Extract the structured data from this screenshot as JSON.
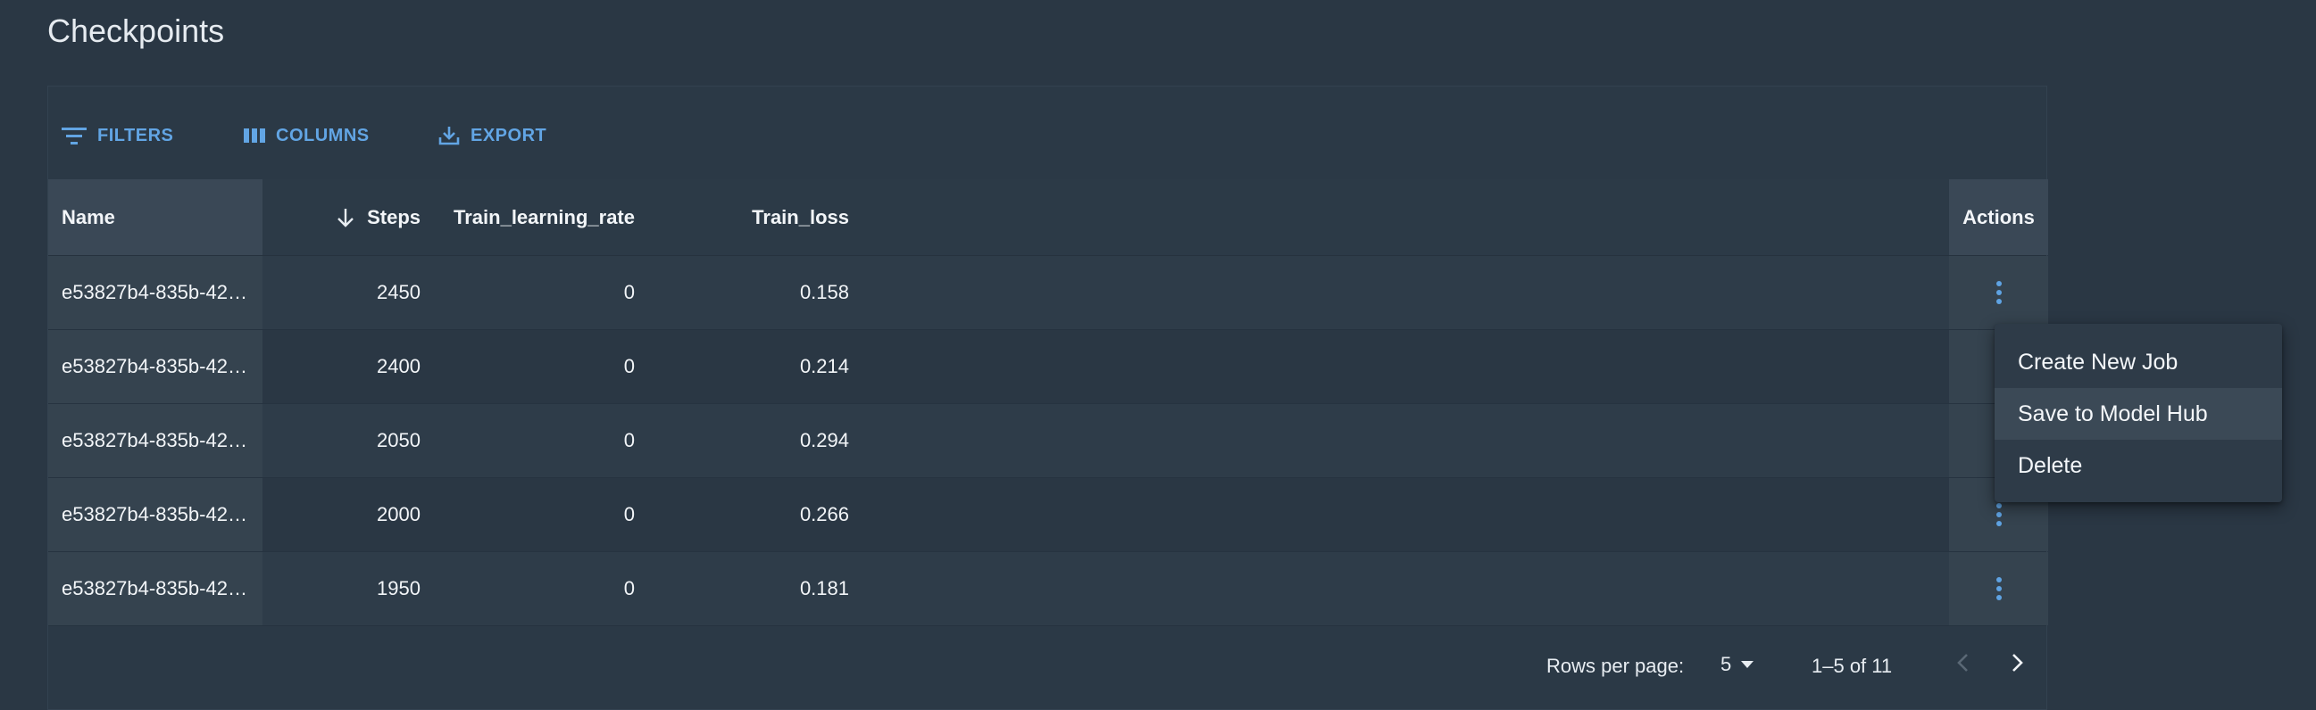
{
  "page": {
    "title": "Checkpoints"
  },
  "toolbar": {
    "filters_label": "FILTERS",
    "columns_label": "COLUMNS",
    "export_label": "EXPORT"
  },
  "table": {
    "headers": {
      "name": "Name",
      "steps": "Steps",
      "lr": "Train_learning_rate",
      "loss": "Train_loss",
      "actions": "Actions"
    },
    "sort": {
      "column": "Steps",
      "direction": "descending"
    },
    "rows": [
      {
        "name": "e53827b4-835b-42…",
        "steps": "2450",
        "lr": "0",
        "loss": "0.158"
      },
      {
        "name": "e53827b4-835b-42…",
        "steps": "2400",
        "lr": "0",
        "loss": "0.214"
      },
      {
        "name": "e53827b4-835b-42…",
        "steps": "2050",
        "lr": "0",
        "loss": "0.294"
      },
      {
        "name": "e53827b4-835b-42…",
        "steps": "2000",
        "lr": "0",
        "loss": "0.266"
      },
      {
        "name": "e53827b4-835b-42…",
        "steps": "1950",
        "lr": "0",
        "loss": "0.181"
      }
    ]
  },
  "pagination": {
    "rows_per_page_label": "Rows per page:",
    "rows_per_page_value": "5",
    "range_text": "1–5 of 11"
  },
  "context_menu": {
    "items": [
      "Create New Job",
      "Save to Model Hub",
      "Delete"
    ],
    "hovered_index": 1
  },
  "colors": {
    "background": "#2a3744",
    "accent": "#62a5e4",
    "menu_bg": "#2e3b48"
  }
}
